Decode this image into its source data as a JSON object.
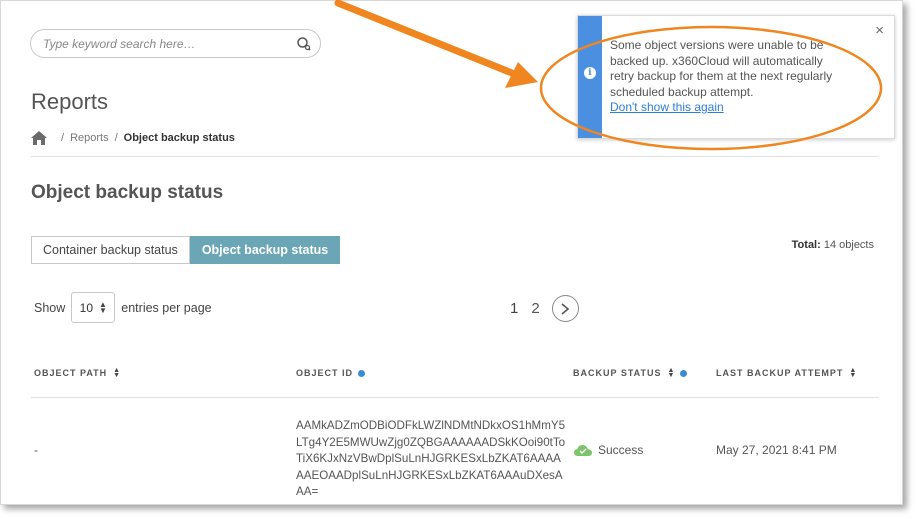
{
  "search": {
    "placeholder": "Type keyword search here…"
  },
  "page": {
    "title": "Reports"
  },
  "breadcrumb": {
    "sep1": "/",
    "reports": "Reports",
    "sep2": "/",
    "current": "Object backup status"
  },
  "section": {
    "title": "Object backup status"
  },
  "tabs": [
    {
      "label": "Container backup status",
      "active": false
    },
    {
      "label": "Object backup status",
      "active": true
    }
  ],
  "total": {
    "label": "Total:",
    "value": "14 objects"
  },
  "entries": {
    "prefix": "Show",
    "value": "10",
    "suffix": "entries per page"
  },
  "pagination": {
    "pages": [
      "1",
      "2"
    ],
    "current": "1"
  },
  "table": {
    "columns": [
      "OBJECT PATH",
      "OBJECT ID",
      "BACKUP STATUS",
      "LAST BACKUP ATTEMPT"
    ],
    "rows": [
      {
        "path": "-",
        "id": "AAMkADZmODBiODFkLWZlNDMtNDkxOS1hMmY5LTg4Y2E5MWUwZjg0ZQBGAAAAAADSkKOoi90tToTiX6KJxNzVBwDplSuLnHJGRKESxLbZKAT6AAAAAAEOAADplSuLnHJGRKESxLbZKAT6AAAuDXesAAA=",
        "status": "Success",
        "last_attempt": "May 27, 2021 8:41 PM"
      }
    ]
  },
  "notification": {
    "message": "Some object versions were unable to be backed up. x360Cloud will automatically retry backup for them at the next regularly scheduled backup attempt.",
    "link": "Don't show this again",
    "close": "×",
    "info_glyph": "i"
  },
  "colors": {
    "active_tab": "#6aa6b5",
    "toast_bar": "#4a8fe0",
    "link": "#2c7fd6",
    "success": "#7cc46a",
    "annotation": "#f0861f"
  }
}
